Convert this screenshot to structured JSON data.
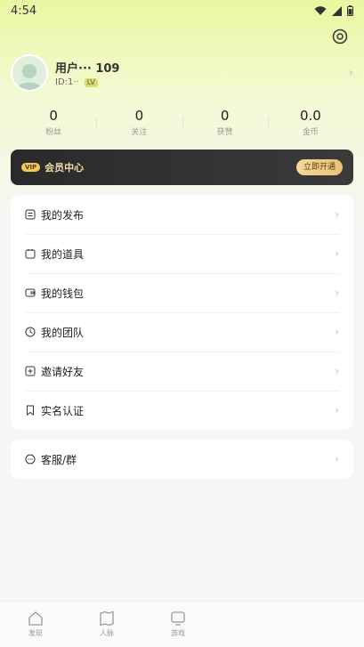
{
  "status_bar": {
    "time": "4:54"
  },
  "profile": {
    "username": "用户··· 109",
    "user_id": "ID:1··",
    "badge": "LV"
  },
  "stats": [
    {
      "value": "0",
      "label": "粉丝"
    },
    {
      "value": "0",
      "label": "关注"
    },
    {
      "value": "0",
      "label": "获赞"
    },
    {
      "value": "0.0",
      "label": "金币"
    }
  ],
  "vip": {
    "tag": "VIP",
    "title": "会员中心",
    "button": "立即开通"
  },
  "menu": [
    {
      "label": "我的发布",
      "icon": "document-icon"
    },
    {
      "label": "我的道具",
      "icon": "box-icon"
    },
    {
      "label": "我的钱包",
      "icon": "wallet-icon"
    },
    {
      "label": "我的团队",
      "icon": "team-icon"
    },
    {
      "label": "邀请好友",
      "icon": "invite-icon"
    },
    {
      "label": "实名认证",
      "icon": "bookmark-icon"
    }
  ],
  "service": {
    "label": "客服/群",
    "icon": "chat-icon"
  },
  "bottom_nav": [
    {
      "label": "发现",
      "icon": "home-icon"
    },
    {
      "label": "人脉",
      "icon": "map-icon"
    },
    {
      "label": "游戏",
      "icon": "tv-icon"
    }
  ]
}
